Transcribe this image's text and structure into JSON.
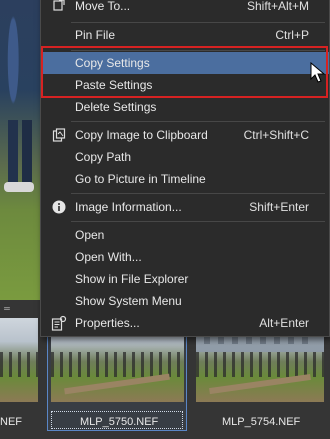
{
  "menu": {
    "items": [
      {
        "label": "Move To...",
        "shortcut": "Shift+Alt+M"
      },
      {
        "label": "Pin File",
        "shortcut": "Ctrl+P"
      },
      {
        "label": "Copy Settings",
        "shortcut": ""
      },
      {
        "label": "Paste Settings",
        "shortcut": ""
      },
      {
        "label": "Delete Settings",
        "shortcut": ""
      },
      {
        "label": "Copy Image to Clipboard",
        "shortcut": "Ctrl+Shift+C"
      },
      {
        "label": "Copy Path",
        "shortcut": ""
      },
      {
        "label": "Go to Picture in Timeline",
        "shortcut": ""
      },
      {
        "label": "Image Information...",
        "shortcut": "Shift+Enter"
      },
      {
        "label": "Open",
        "shortcut": ""
      },
      {
        "label": "Open With...",
        "shortcut": ""
      },
      {
        "label": "Show in File Explorer",
        "shortcut": ""
      },
      {
        "label": "Show System Menu",
        "shortcut": ""
      },
      {
        "label": "Properties...",
        "shortcut": "Alt+Enter"
      }
    ],
    "hovered_item": "Copy Settings",
    "highlight_color": "#d62222",
    "hover_color": "#4b6e9f"
  },
  "thumbnails": [
    {
      "label": "NEF"
    },
    {
      "label": "MLP_5750.NEF"
    },
    {
      "label": "MLP_5754.NEF"
    }
  ],
  "icons": {
    "move": "move-icon",
    "copy_image": "clipboard-icon",
    "info": "info-icon",
    "properties": "properties-icon"
  }
}
